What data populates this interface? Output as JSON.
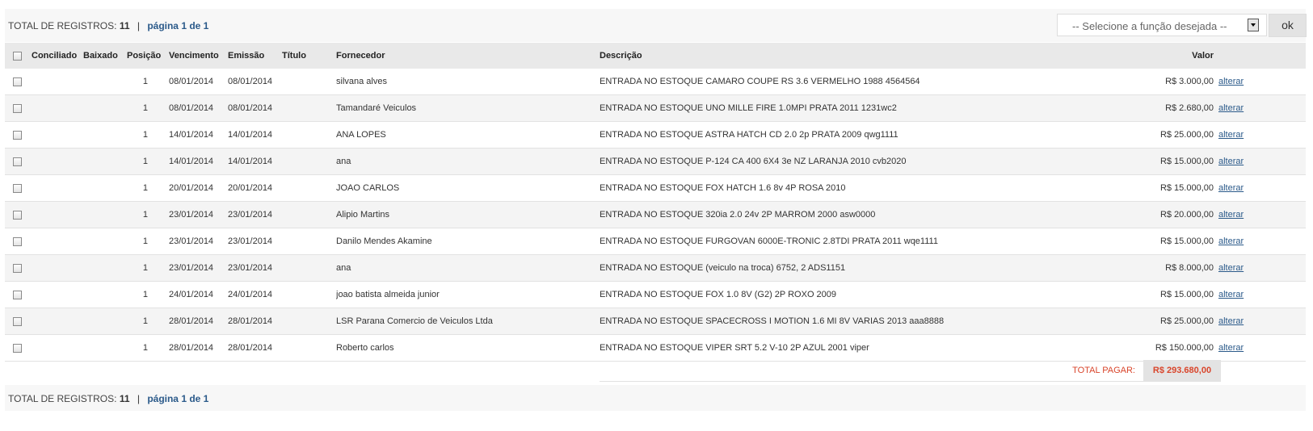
{
  "pagination": {
    "total_label": "TOTAL DE REGISTROS:",
    "total_count": "11",
    "separator": "|",
    "page_label": "página 1 de 1"
  },
  "action": {
    "select_placeholder": "-- Selecione a função desejada --",
    "ok_label": "ok"
  },
  "table": {
    "headers": {
      "conciliado": "Conciliado",
      "baixado": "Baixado",
      "posicao": "Posição",
      "vencimento": "Vencimento",
      "emissao": "Emissão",
      "titulo": "Título",
      "fornecedor": "Fornecedor",
      "descricao": "Descrição",
      "valor": "Valor"
    },
    "rows": [
      {
        "posicao": "1",
        "vencimento": "08/01/2014",
        "emissao": "08/01/2014",
        "titulo": "",
        "fornecedor": "silvana alves",
        "descricao": "ENTRADA NO ESTOQUE CAMARO COUPE RS 3.6 VERMELHO 1988 4564564",
        "valor": "R$ 3.000,00",
        "acao": "alterar"
      },
      {
        "posicao": "1",
        "vencimento": "08/01/2014",
        "emissao": "08/01/2014",
        "titulo": "",
        "fornecedor": "Tamandaré Veiculos",
        "descricao": "ENTRADA NO ESTOQUE UNO MILLE FIRE 1.0MPI PRATA 2011 1231wc2",
        "valor": "R$ 2.680,00",
        "acao": "alterar"
      },
      {
        "posicao": "1",
        "vencimento": "14/01/2014",
        "emissao": "14/01/2014",
        "titulo": "",
        "fornecedor": "ANA LOPES",
        "descricao": "ENTRADA NO ESTOQUE ASTRA HATCH CD 2.0 2p PRATA 2009 qwg1111",
        "valor": "R$ 25.000,00",
        "acao": "alterar"
      },
      {
        "posicao": "1",
        "vencimento": "14/01/2014",
        "emissao": "14/01/2014",
        "titulo": "",
        "fornecedor": "ana",
        "descricao": "ENTRADA NO ESTOQUE P-124 CA 400 6X4 3e NZ LARANJA 2010 cvb2020",
        "valor": "R$ 15.000,00",
        "acao": "alterar"
      },
      {
        "posicao": "1",
        "vencimento": "20/01/2014",
        "emissao": "20/01/2014",
        "titulo": "",
        "fornecedor": "JOAO CARLOS",
        "descricao": "ENTRADA NO ESTOQUE FOX HATCH 1.6 8v 4P ROSA 2010",
        "valor": "R$ 15.000,00",
        "acao": "alterar"
      },
      {
        "posicao": "1",
        "vencimento": "23/01/2014",
        "emissao": "23/01/2014",
        "titulo": "",
        "fornecedor": "Alipio Martins",
        "descricao": "ENTRADA NO ESTOQUE 320ia 2.0 24v 2P MARROM 2000 asw0000",
        "valor": "R$ 20.000,00",
        "acao": "alterar"
      },
      {
        "posicao": "1",
        "vencimento": "23/01/2014",
        "emissao": "23/01/2014",
        "titulo": "",
        "fornecedor": "Danilo Mendes Akamine",
        "descricao": "ENTRADA NO ESTOQUE FURGOVAN 6000E-TRONIC 2.8TDI PRATA 2011 wqe1111",
        "valor": "R$ 15.000,00",
        "acao": "alterar"
      },
      {
        "posicao": "1",
        "vencimento": "23/01/2014",
        "emissao": "23/01/2014",
        "titulo": "",
        "fornecedor": "ana",
        "descricao": "ENTRADA NO ESTOQUE (veiculo na troca) 6752, 2 ADS1151",
        "valor": "R$ 8.000,00",
        "acao": "alterar"
      },
      {
        "posicao": "1",
        "vencimento": "24/01/2014",
        "emissao": "24/01/2014",
        "titulo": "",
        "fornecedor": "joao batista almeida junior",
        "descricao": "ENTRADA NO ESTOQUE FOX 1.0 8V (G2) 2P ROXO 2009",
        "valor": "R$ 15.000,00",
        "acao": "alterar"
      },
      {
        "posicao": "1",
        "vencimento": "28/01/2014",
        "emissao": "28/01/2014",
        "titulo": "",
        "fornecedor": "LSR Parana Comercio de Veiculos Ltda",
        "descricao": "ENTRADA NO ESTOQUE SPACECROSS I MOTION 1.6 MI 8V VARIAS 2013 aaa8888",
        "valor": "R$ 25.000,00",
        "acao": "alterar"
      },
      {
        "posicao": "1",
        "vencimento": "28/01/2014",
        "emissao": "28/01/2014",
        "titulo": "",
        "fornecedor": "Roberto carlos",
        "descricao": "ENTRADA NO ESTOQUE VIPER SRT 5.2 V-10 2P AZUL 2001 viper",
        "valor": "R$ 150.000,00",
        "acao": "alterar"
      }
    ],
    "total_label": "TOTAL PAGAR:",
    "total_value": "R$ 293.680,00"
  },
  "colors": {
    "value_red": "#d9452b",
    "link_blue": "#2b5a8a",
    "header_bg": "#e9e9e9"
  }
}
